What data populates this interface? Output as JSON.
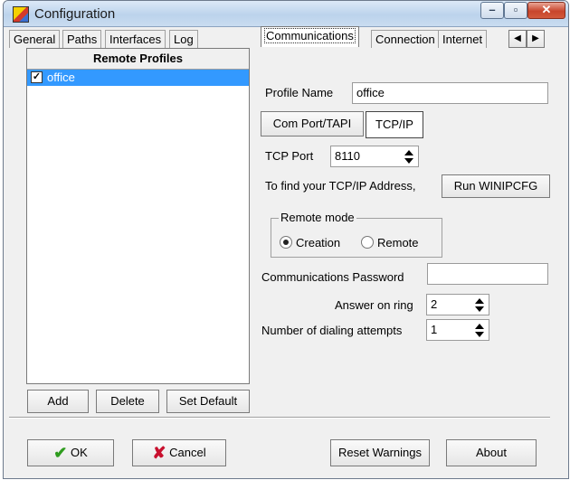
{
  "window": {
    "title": "Configuration"
  },
  "tabs": [
    {
      "label": "General"
    },
    {
      "label": "Paths"
    },
    {
      "label": "Interfaces"
    },
    {
      "label": "Log"
    },
    {
      "label": "Communications"
    },
    {
      "label": "Connection"
    },
    {
      "label": "Internet"
    }
  ],
  "profiles": {
    "header": "Remote Profiles",
    "items": [
      {
        "label": "office",
        "checked": true
      }
    ],
    "add_label": "Add",
    "delete_label": "Delete",
    "set_default_label": "Set Default"
  },
  "comm": {
    "profile_name_label": "Profile Name",
    "profile_name_value": "office",
    "subtab_com": "Com Port/TAPI",
    "subtab_tcp": "TCP/IP",
    "tcp_port_label": "TCP Port",
    "tcp_port_value": "8110",
    "find_ip_label": "To find your TCP/IP Address,",
    "run_winipcfg_label": "Run WINIPCFG",
    "remote_mode_legend": "Remote mode",
    "radio_creation": "Creation",
    "radio_remote": "Remote",
    "password_label": "Communications Password",
    "password_value": "",
    "answer_ring_label": "Answer on ring",
    "answer_ring_value": "2",
    "dial_attempts_label": "Number of dialing attempts",
    "dial_attempts_value": "1"
  },
  "footer": {
    "ok_label": "OK",
    "cancel_label": "Cancel",
    "reset_warnings_label": "Reset Warnings",
    "about_label": "About"
  },
  "icons": {
    "ok": "checkmark-icon",
    "cancel": "x-icon",
    "app": "configuration-app-icon"
  },
  "colors": {
    "selection": "#3399ff",
    "ok_check": "#2e9c1e",
    "cancel_x": "#c8102e"
  }
}
